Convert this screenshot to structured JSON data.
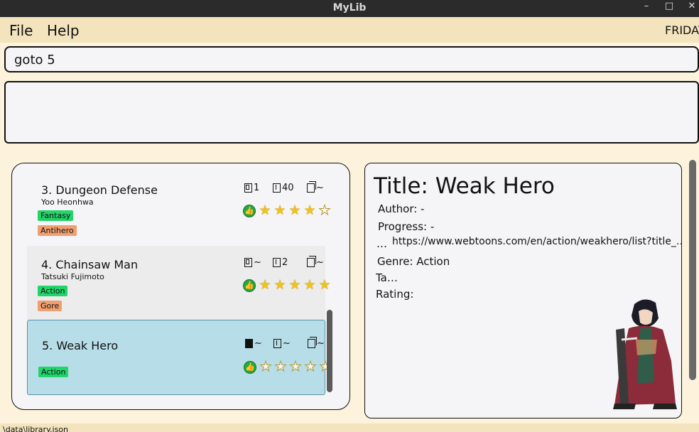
{
  "window": {
    "title": "MyLib"
  },
  "menu": {
    "file": "File",
    "help": "Help",
    "day": "FRIDAY"
  },
  "command": {
    "value": "goto 5"
  },
  "result": {
    "text": ""
  },
  "list": {
    "items": [
      {
        "name": "3. Dungeon Defense",
        "author": "Yoo Heonhwa",
        "tags": [
          "Fantasy",
          "Antihero"
        ],
        "chapter": "1",
        "volume": "40",
        "copies": "~",
        "rating": 4
      },
      {
        "name": "4. Chainsaw Man",
        "author": "Tatsuki Fujimoto",
        "tags": [
          "Action",
          "Gore"
        ],
        "chapter": "~",
        "volume": "2",
        "copies": "~",
        "rating": 5
      },
      {
        "name": "5. Weak Hero",
        "author": "",
        "tags": [
          "Action"
        ],
        "chapter": "~",
        "volume": "~",
        "copies": "~",
        "rating": 0
      }
    ]
  },
  "detail": {
    "title": "Title: Weak Hero",
    "author": "Author: -",
    "progress": "Progress: -",
    "link_prefix": "…",
    "link": "https://www.webtoons.com/en/action/weakhero/list?title_…",
    "genre": "Genre: Action",
    "tags": "Ta…",
    "rating": "Rating:"
  },
  "status": {
    "path": "\\data\\library.json"
  },
  "colors": {
    "background": "#fdf3dc",
    "menubar": "#f3e4bd",
    "selected": "#b7dde8",
    "tag_green": "#22d46a",
    "tag_orange": "#f0a070",
    "star": "#f1c21b"
  },
  "icons": {
    "chapter": "bookmark-icon",
    "volume": "book-icon",
    "copies": "copy-icon",
    "like": "thumbs-up-icon",
    "star": "star-icon"
  }
}
